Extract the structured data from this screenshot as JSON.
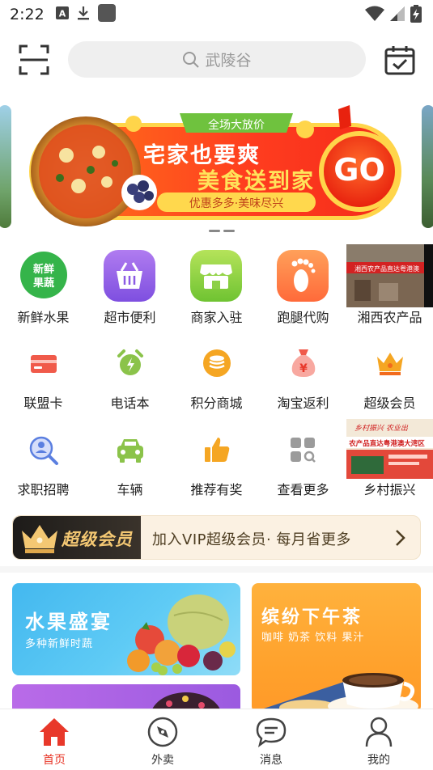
{
  "status_bar": {
    "time": "2:22"
  },
  "header": {
    "search_placeholder": "武陵谷"
  },
  "banner": {
    "top_tag": "全场大放价",
    "headline_1": "宅家也要爽",
    "headline_2": "美食送到家",
    "go_label": "GO",
    "slogan": "优惠多多·美味尽兴"
  },
  "grid": {
    "row1": [
      {
        "label": "新鲜水果",
        "icon_text": "新鲜果蔬",
        "icon": "fruit-veg-icon"
      },
      {
        "label": "超市便利",
        "icon": "basket-icon"
      },
      {
        "label": "商家入驻",
        "icon": "store-icon"
      },
      {
        "label": "跑腿代购",
        "icon": "footprint-icon"
      },
      {
        "label": "湘西农产品",
        "icon": "market-photo"
      }
    ],
    "row2": [
      {
        "label": "联盟卡",
        "icon": "card-icon"
      },
      {
        "label": "电话本",
        "icon": "alarm-clock-icon"
      },
      {
        "label": "积分商城",
        "icon": "coin-stack-icon"
      },
      {
        "label": "淘宝返利",
        "icon": "money-bag-icon"
      },
      {
        "label": "超级会员",
        "icon": "crown-icon"
      }
    ],
    "row3": [
      {
        "label": "求职招聘",
        "icon": "job-search-icon"
      },
      {
        "label": "车辆",
        "icon": "car-icon"
      },
      {
        "label": "推荐有奖",
        "icon": "thumbs-up-icon"
      },
      {
        "label": "查看更多",
        "icon": "more-grid-icon"
      },
      {
        "label": "乡村振兴",
        "icon": "billboard-photo"
      }
    ]
  },
  "vip": {
    "badge": "超级会员",
    "text": "加入VIP超级会员· 每月省更多"
  },
  "promos": {
    "fruit": {
      "title": "水果盛宴",
      "subtitle": "多种新鲜时蔬"
    },
    "tea": {
      "title": "缤纷下午茶",
      "subtitle": "咖啡 奶茶 饮料 果汁"
    }
  },
  "tabbar": [
    {
      "label": "首页",
      "icon": "home-icon",
      "active": true
    },
    {
      "label": "外卖",
      "icon": "compass-icon",
      "active": false
    },
    {
      "label": "消息",
      "icon": "chat-bubble-icon",
      "active": false
    },
    {
      "label": "我的",
      "icon": "person-icon",
      "active": false
    }
  ],
  "colors": {
    "accent_red": "#e8382a",
    "vip_gold": "#f4c873",
    "icon_red": "#f05a4a",
    "icon_orange": "#f5a623",
    "icon_green": "#8bc34a",
    "icon_blue": "#5b7fe0"
  }
}
